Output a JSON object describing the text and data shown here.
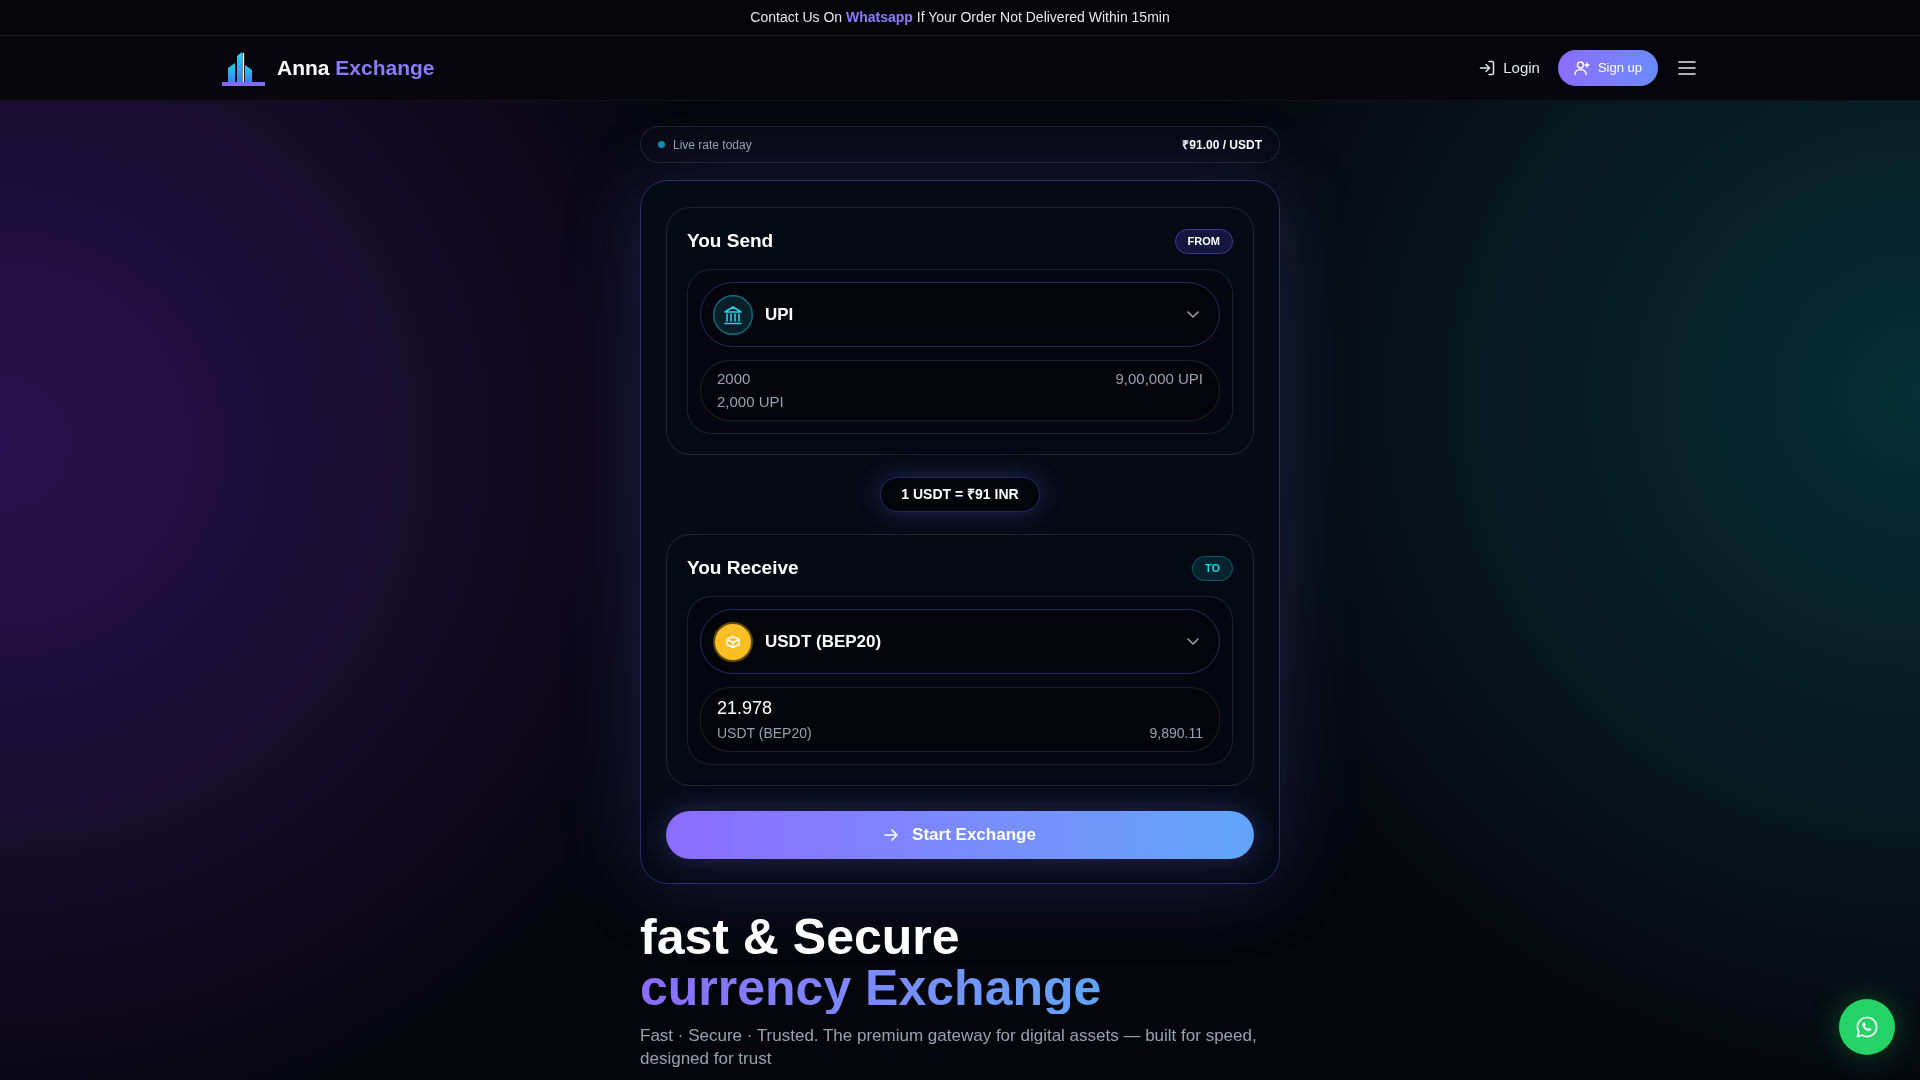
{
  "announcement": {
    "before": "Contact Us On",
    "link": "Whatsapp",
    "after": "If Your Order Not Delivered Within 15min"
  },
  "header": {
    "brand": "Anna",
    "brand_accent": "Exchange",
    "login": "Login",
    "signup": "Sign up"
  },
  "rate_bar": {
    "label": "Live rate today",
    "value": "₹91.00 / USDT"
  },
  "exchange": {
    "panels": [
      {
        "kind": "from",
        "title": "You Send",
        "tag": "FROM",
        "asset": "UPI",
        "amount": "2000",
        "caption": "2,000 UPI",
        "side_value": "9,00,000 UPI"
      },
      {
        "kind": "to",
        "title": "You Receive",
        "tag": "TO",
        "asset": "USDT (BEP20)",
        "amount": "21.978",
        "caption": "USDT (BEP20)",
        "side_value": "9,890.11"
      }
    ],
    "rate": "1 USDT = ₹91 INR",
    "submit": "Start Exchange"
  },
  "hero": {
    "title": "fast & Secure",
    "title_accent": "currency Exchange",
    "text": "Fast · Secure · Trusted. The premium gateway for digital assets — built for speed, designed for trust"
  }
}
